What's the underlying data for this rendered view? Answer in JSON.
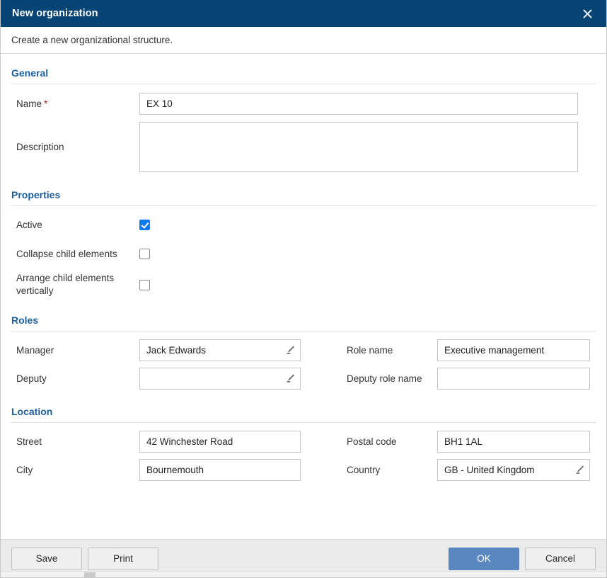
{
  "window": {
    "title": "New organization",
    "close_icon": "close-icon",
    "subtitle": "Create a new organizational structure."
  },
  "colors": {
    "titlebar_bg": "#054474",
    "section_heading": "#1b5e9e",
    "checkbox_checked": "#0b78f0",
    "primary_button": "#5a87c0",
    "required_star": "#a02020",
    "footer_bg": "#ebebeb"
  },
  "sections": {
    "general": {
      "heading": "General",
      "name": {
        "label": "Name",
        "required_marker": "*",
        "value": "EX 10",
        "placeholder": ""
      },
      "description": {
        "label": "Description",
        "value": "",
        "placeholder": ""
      }
    },
    "properties": {
      "heading": "Properties",
      "items": [
        {
          "label": "Active",
          "checked": true
        },
        {
          "label": "Collapse child elements",
          "checked": false
        },
        {
          "label": "Arrange child elements vertically",
          "checked": false
        }
      ]
    },
    "roles": {
      "heading": "Roles",
      "manager": {
        "label": "Manager",
        "value": "Jack Edwards",
        "placeholder": "",
        "icon": "pencil-icon"
      },
      "role_name": {
        "label": "Role name",
        "value": "Executive management",
        "placeholder": ""
      },
      "deputy": {
        "label": "Deputy",
        "value": "",
        "placeholder": "",
        "icon": "pencil-icon"
      },
      "deputy_role_name": {
        "label": "Deputy role name",
        "value": "",
        "placeholder": ""
      }
    },
    "location": {
      "heading": "Location",
      "street": {
        "label": "Street",
        "value": "42 Winchester Road",
        "placeholder": ""
      },
      "postal_code": {
        "label": "Postal code",
        "value": "BH1 1AL",
        "placeholder": ""
      },
      "city": {
        "label": "City",
        "value": "Bournemouth",
        "placeholder": ""
      },
      "country": {
        "label": "Country",
        "value": "GB - United Kingdom",
        "placeholder": "",
        "icon": "pencil-icon"
      }
    }
  },
  "footer": {
    "save_label": "Save",
    "print_label": "Print",
    "ok_label": "OK",
    "cancel_label": "Cancel"
  }
}
